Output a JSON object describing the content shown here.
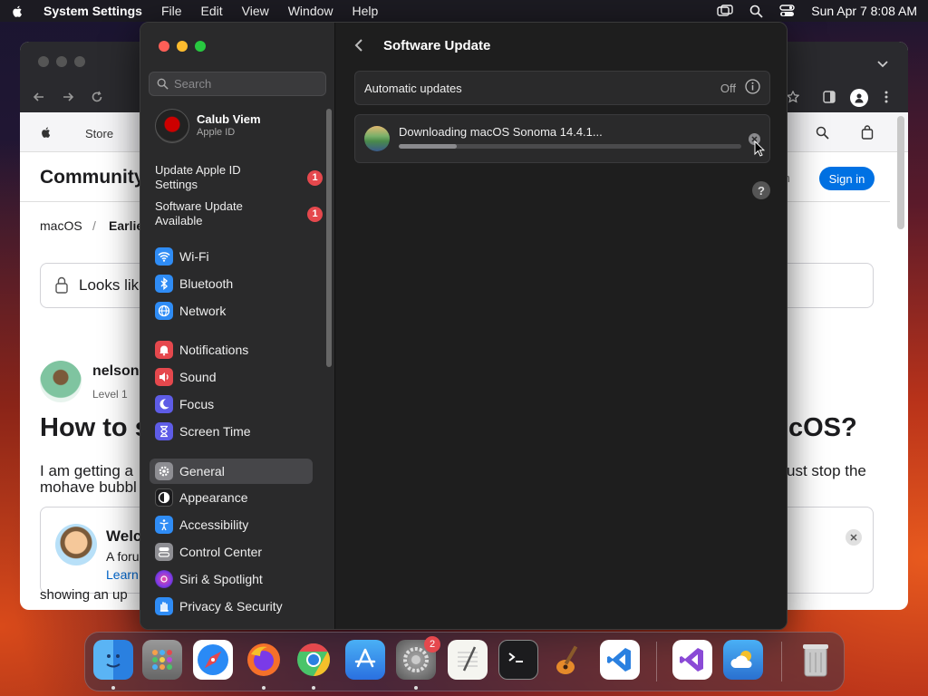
{
  "menubar": {
    "app_name": "System Settings",
    "menus": [
      "File",
      "Edit",
      "View",
      "Window",
      "Help"
    ],
    "clock": "Sun Apr 7  8:08 AM"
  },
  "browser": {
    "nav_store": "Store",
    "community": "Community",
    "sign_in": "Sign in",
    "search_partial": "ch",
    "breadcrumb_1": "macOS",
    "breadcrumb_sep": "/",
    "breadcrumb_2": "Earlie",
    "lock_text": "Looks lik",
    "user_name": "nelson",
    "user_level": "Level 1",
    "question_start": "How to s",
    "question_end": "cOS?",
    "body_line1_start": "I am getting a",
    "body_line1_end": "ust stop the",
    "body_line2": "mohave bubbl",
    "welcome_title": "Welc",
    "welcome_line": "A foru",
    "welcome_link": "Learn",
    "footer_partial": "showing an up"
  },
  "settings": {
    "search_placeholder": "Search",
    "account_name": "Calub Viem",
    "account_sub": "Apple ID",
    "notices": [
      {
        "label": "Update Apple ID Settings",
        "badge": "1"
      },
      {
        "label": "Software Update Available",
        "badge": "1"
      }
    ],
    "items": [
      {
        "label": "Wi-Fi",
        "icon": "wifi-icon",
        "color": "#2f8cf5"
      },
      {
        "label": "Bluetooth",
        "icon": "bluetooth-icon",
        "color": "#2f8cf5"
      },
      {
        "label": "Network",
        "icon": "globe-icon",
        "color": "#2f8cf5"
      },
      {
        "label": "Notifications",
        "icon": "bell-icon",
        "color": "#e5484d"
      },
      {
        "label": "Sound",
        "icon": "speaker-icon",
        "color": "#e5484d"
      },
      {
        "label": "Focus",
        "icon": "moon-icon",
        "color": "#5e5ce6"
      },
      {
        "label": "Screen Time",
        "icon": "hourglass-icon",
        "color": "#5e5ce6"
      },
      {
        "label": "General",
        "icon": "gear-icon",
        "color": "#8e8e93"
      },
      {
        "label": "Appearance",
        "icon": "appearance-icon",
        "color": "#1c1c1e"
      },
      {
        "label": "Accessibility",
        "icon": "accessibility-icon",
        "color": "#2f8cf5"
      },
      {
        "label": "Control Center",
        "icon": "control-center-icon",
        "color": "#8e8e93"
      },
      {
        "label": "Siri & Spotlight",
        "icon": "siri-icon",
        "color": "#b84ad6"
      },
      {
        "label": "Privacy & Security",
        "icon": "hand-icon",
        "color": "#2f8cf5"
      }
    ],
    "selected": "General"
  },
  "content": {
    "title": "Software Update",
    "auto_updates_label": "Automatic updates",
    "auto_updates_value": "Off",
    "download_text": "Downloading macOS Sonoma 14.4.1...",
    "download_progress": 0.17,
    "help": "?"
  },
  "dock": {
    "settings_badge": "2"
  }
}
